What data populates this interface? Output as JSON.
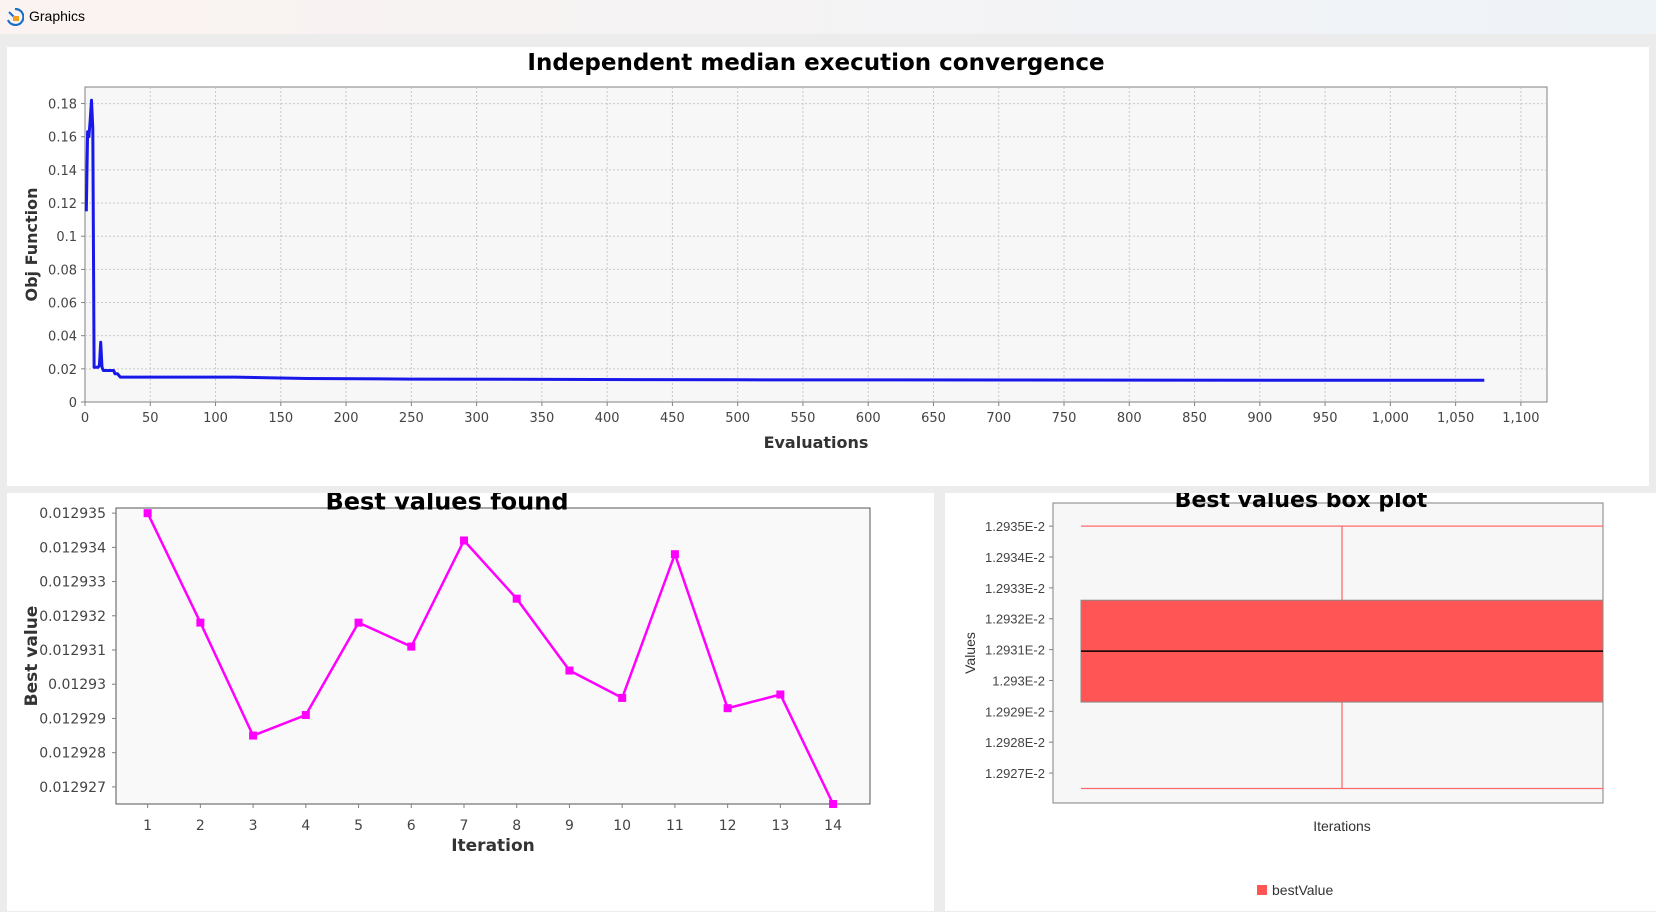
{
  "window": {
    "title": "Graphics",
    "icon": "app-icon"
  },
  "colors": {
    "convergence_line": "#1818e8",
    "best_line": "#ff00ff",
    "box_fill": "#ff5555",
    "box_edge": "#ff6b6b",
    "plot_bg": "#f7f7f7",
    "grid": "#c8c8c8"
  },
  "chart_data": [
    {
      "type": "line",
      "title": "Independent median execution convergence",
      "xlabel": "Evaluations",
      "ylabel": "Obj Function",
      "xlim": [
        0,
        1120
      ],
      "ylim": [
        0,
        0.19
      ],
      "grid": true,
      "xticks": [
        0,
        50,
        100,
        150,
        200,
        250,
        300,
        350,
        400,
        450,
        500,
        550,
        600,
        650,
        700,
        750,
        800,
        850,
        900,
        950,
        1000,
        1050,
        1100
      ],
      "xtick_labels": [
        "0",
        "50",
        "100",
        "150",
        "200",
        "250",
        "300",
        "350",
        "400",
        "450",
        "500",
        "550",
        "600",
        "650",
        "700",
        "750",
        "800",
        "850",
        "900",
        "950",
        "1,000",
        "1,050",
        "1,100"
      ],
      "yticks": [
        0,
        0.02,
        0.04,
        0.06,
        0.08,
        0.1,
        0.12,
        0.14,
        0.16,
        0.18
      ],
      "ytick_labels": [
        "0",
        "0.02",
        "0.04",
        "0.06",
        "0.08",
        "0.1",
        "0.12",
        "0.14",
        "0.16",
        "0.18"
      ],
      "series": [
        {
          "x": [
            1,
            2,
            3,
            4,
            5,
            6,
            7,
            8,
            10,
            11,
            12,
            13,
            14,
            16,
            18,
            20,
            22,
            23,
            25,
            27,
            30,
            115,
            170,
            250,
            500,
            1000,
            1072
          ],
          "y": [
            0.115,
            0.163,
            0.16,
            0.17,
            0.182,
            0.165,
            0.021,
            0.021,
            0.021,
            0.022,
            0.036,
            0.021,
            0.019,
            0.019,
            0.019,
            0.019,
            0.019,
            0.017,
            0.017,
            0.015,
            0.015,
            0.015,
            0.0142,
            0.0138,
            0.0134,
            0.0131,
            0.0131
          ]
        }
      ]
    },
    {
      "type": "line",
      "title": "Best values found",
      "xlabel": "Iteration",
      "ylabel": "Best value",
      "xlim": [
        0.4,
        14.7
      ],
      "ylim": [
        0.0129265,
        0.01293515
      ],
      "grid": false,
      "categories": [
        "1",
        "2",
        "3",
        "4",
        "5",
        "6",
        "7",
        "8",
        "9",
        "10",
        "11",
        "12",
        "13",
        "14"
      ],
      "ytick_labels": [
        "0.012927",
        "0.012928",
        "0.012929",
        "0.01293",
        "0.012931",
        "0.012932",
        "0.012933",
        "0.012934",
        "0.012935"
      ],
      "yticks": [
        0.012927,
        0.012928,
        0.012929,
        0.01293,
        0.012931,
        0.012932,
        0.012933,
        0.012934,
        0.012935
      ],
      "series": [
        {
          "x": [
            1,
            2,
            3,
            4,
            5,
            6,
            7,
            8,
            9,
            10,
            11,
            12,
            13,
            14
          ],
          "values": [
            0.012935,
            0.0129318,
            0.0129285,
            0.0129291,
            0.0129318,
            0.0129311,
            0.0129342,
            0.0129325,
            0.0129304,
            0.0129296,
            0.0129338,
            0.0129293,
            0.0129297,
            0.0129265
          ]
        }
      ]
    },
    {
      "type": "box",
      "title": "Best values box plot",
      "xlabel": "Iterations",
      "ylabel": "Values",
      "ylim": [
        0.01292603,
        0.01293575
      ],
      "ytick_labels": [
        "1.2927E-2",
        "1.2928E-2",
        "1.2929E-2",
        "1.293E-2",
        "1.2931E-2",
        "1.2932E-2",
        "1.2933E-2",
        "1.2934E-2",
        "1.2935E-2"
      ],
      "yticks": [
        0.012927,
        0.012928,
        0.012929,
        0.01293,
        0.012931,
        0.012932,
        0.012933,
        0.012934,
        0.012935
      ],
      "legend": [
        "bestValue"
      ],
      "legend_position": "bottom",
      "box": {
        "min": 0.0129265,
        "q1": 0.0129293,
        "median": 0.01293095,
        "q3": 0.0129326,
        "max": 0.012935
      }
    }
  ]
}
